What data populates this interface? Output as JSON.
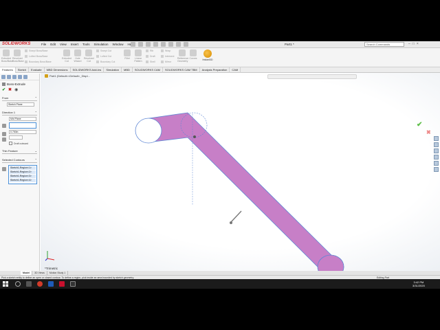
{
  "app": {
    "logo": "SOLIDWORKS",
    "menus": [
      "File",
      "Edit",
      "View",
      "Insert",
      "Tools",
      "Simulation",
      "Window",
      "Help"
    ],
    "doc_title": "Part1 *",
    "search_placeholder": "Search Commands"
  },
  "ribbon": {
    "big_buttons": [
      "Extruded Boss/Base",
      "Revolved Boss/Base",
      "Extruded Cut",
      "Hole Wizard",
      "Revolved Cut",
      "Fillet",
      "Linear Pattern",
      "Rib",
      "Reference Geometry",
      "Curves"
    ],
    "small_buttons": [
      "Swept Boss/Base",
      "Lofted Boss/Base",
      "Boundary Boss/Base",
      "Swept Cut",
      "Lofted Cut",
      "Boundary Cut",
      "Draft",
      "Shell",
      "Wrap",
      "Intersect",
      "Mirror"
    ],
    "instant3d": "Instant3D"
  },
  "tabs": [
    "Features",
    "Sketch",
    "Evaluate",
    "MBD Dimensions",
    "SOLIDWORKS Add-Ins",
    "Simulation",
    "MBD",
    "SOLIDWORKS CAM",
    "SOLIDWORKS CAM TBM",
    "Analysis Preparation",
    "CAM"
  ],
  "property_manager": {
    "title": "Boss-Extrude",
    "from_label": "From",
    "from_value": "Sketch Plane",
    "direction_label": "Direction 1",
    "direction_value": "Mid Plane",
    "depth_value": "0.750in",
    "draft_label": "Draft outward",
    "thin_label": "Thin Feature",
    "contours_label": "Selected Contours",
    "contours": [
      "Sketch1-Region<1>",
      "Sketch1-Region<2>",
      "Sketch1-Region<3>",
      "Sketch1-Region<4>"
    ]
  },
  "viewport": {
    "tree_label": "Part1 (Default<<Default>_Displ...",
    "view_name": "*Trimetric",
    "accent": "#c77fc7"
  },
  "bottom_tabs": [
    "Model",
    "3D Views",
    "Motion Study 1"
  ],
  "status": {
    "message": "Pick a sketch entity to define an open or closed contour. To define a region, pick inside an area bounded by sketch geometry.",
    "mode": "Editing Part"
  },
  "taskbar": {
    "time": "3:42 PM",
    "date": "3/31/2020"
  }
}
